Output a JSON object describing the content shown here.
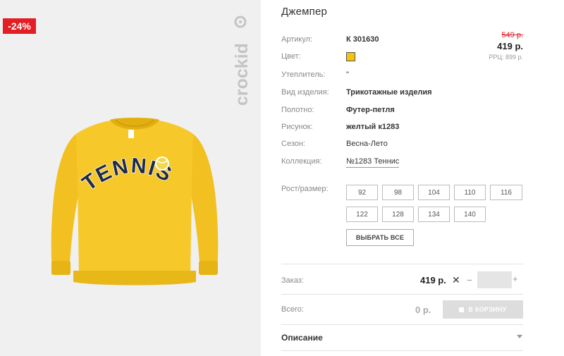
{
  "product": {
    "discount": "-24%",
    "brand": "crockid",
    "print_text": "TENNIS",
    "title": "Джемпер",
    "swatch_color": "#f3c30f"
  },
  "attributes": {
    "article": {
      "label": "Артикул:",
      "value": "К 301630"
    },
    "color": {
      "label": "Цвет:"
    },
    "insulation": {
      "label": "Утеплитель:",
      "value": "\""
    },
    "type": {
      "label": "Вид изделия:",
      "value": "Трикотажные изделия"
    },
    "fabric": {
      "label": "Полотно:",
      "value": "Футер-петля"
    },
    "pattern": {
      "label": "Рисунок:",
      "value": "желтый к1283"
    },
    "season": {
      "label": "Сезон:",
      "value": "Весна-Лето"
    },
    "collection": {
      "label": "Коллекция:",
      "value": "№1283 Теннис"
    }
  },
  "price": {
    "old": "549 р.",
    "current": "419 р.",
    "rrp": "РРЦ: 899 р."
  },
  "sizes": {
    "label": "Рост/размер:",
    "options": [
      "92",
      "98",
      "104",
      "110",
      "116",
      "122",
      "128",
      "134",
      "140"
    ],
    "select_all": "ВЫБРАТЬ ВСЕ"
  },
  "order": {
    "label": "Заказ:",
    "price": "419 р.",
    "times": "✕",
    "minus": "−",
    "plus": "+",
    "quantity": ""
  },
  "total": {
    "label": "Всего:",
    "value": "0 р.",
    "cart_button": "В КОРЗИНУ"
  },
  "description": {
    "label": "Описание"
  }
}
